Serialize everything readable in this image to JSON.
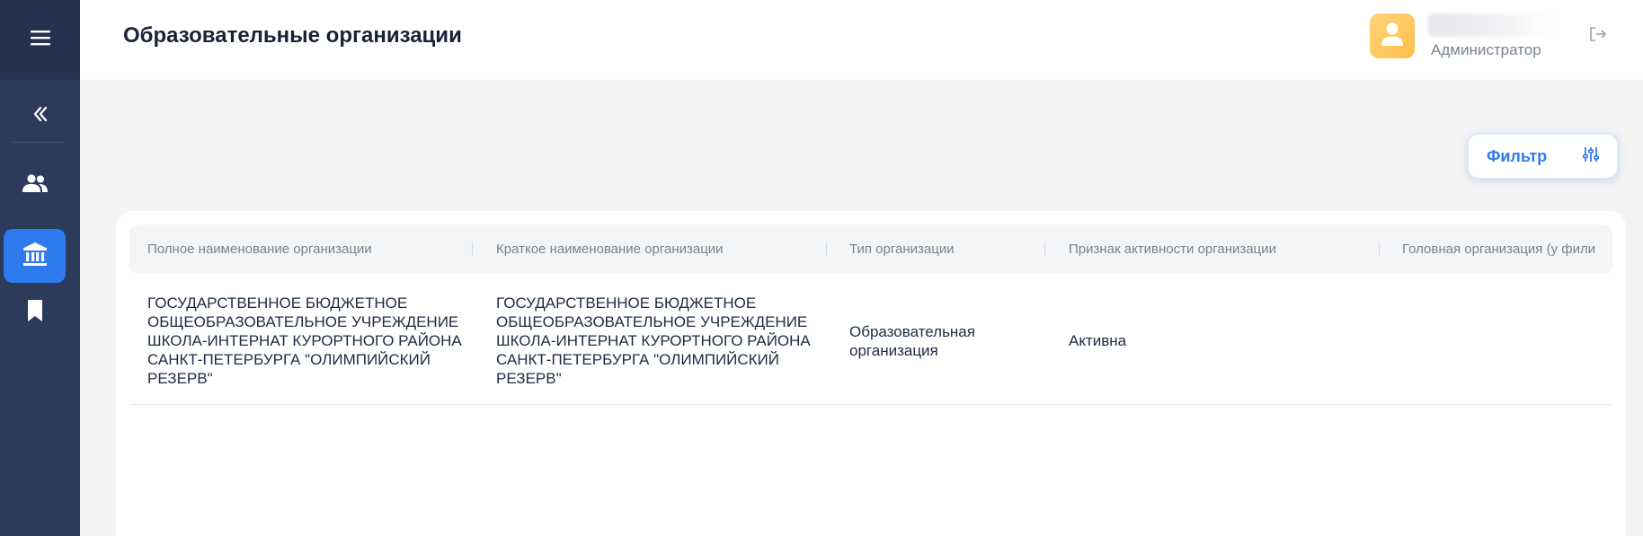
{
  "header": {
    "title": "Образовательные организации",
    "role": "Администратор"
  },
  "filter": {
    "label": "Фильтр"
  },
  "table": {
    "columns": [
      "Полное наименование организации",
      "Краткое наименование организации",
      "Тип организации",
      "Признак активности организации",
      "Головная организация (у фили"
    ],
    "rows": [
      {
        "full_name": "ГОСУДАРСТВЕННОЕ БЮДЖЕТНОЕ ОБЩЕОБРАЗОВАТЕЛЬНОЕ УЧРЕЖДЕНИЕ ШКОЛА-ИНТЕРНАТ КУРОРТНОГО РАЙОНА САНКТ-ПЕТЕРБУРГА \"ОЛИМПИЙСКИЙ РЕЗЕРВ\"",
        "short_name": "ГОСУДАРСТВЕННОЕ БЮДЖЕТНОЕ ОБЩЕОБРАЗОВАТЕЛЬНОЕ УЧРЕЖДЕНИЕ ШКОЛА-ИНТЕРНАТ КУРОРТНОГО РАЙОНА САНКТ-ПЕТЕРБУРГА \"ОЛИМПИЙСКИЙ РЕЗЕРВ\"",
        "type": "Образовательная организация",
        "activity": "Активна",
        "parent": ""
      }
    ]
  },
  "colors": {
    "sidebar": "#2c3a5c",
    "sidebar_top": "#25324f",
    "accent": "#2e7bf0",
    "avatar": "#ffc65c"
  },
  "icons": [
    "menu-icon",
    "chevrons-left-icon",
    "users-icon",
    "institution-icon",
    "bookmark-icon",
    "user-icon",
    "logout-icon",
    "filter-sliders-icon"
  ]
}
